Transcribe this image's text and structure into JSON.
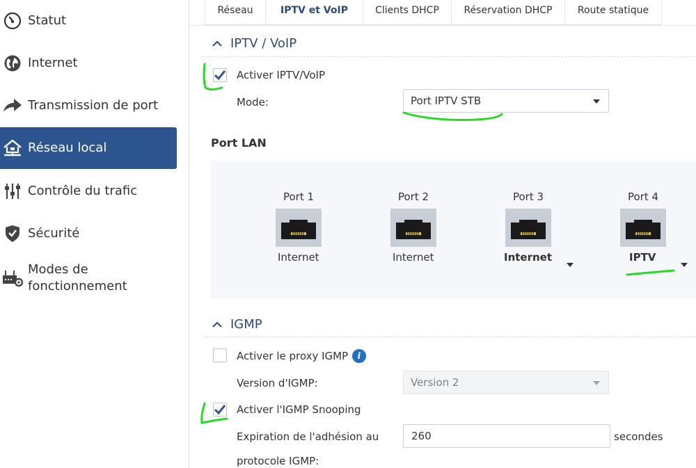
{
  "sidebar": {
    "items": [
      {
        "label": "Statut",
        "icon": "gauge-icon"
      },
      {
        "label": "Internet",
        "icon": "globe-icon"
      },
      {
        "label": "Transmission de port",
        "icon": "arrow-forward-icon"
      },
      {
        "label": "Réseau local",
        "icon": "home-network-icon",
        "active": true
      },
      {
        "label": "Contrôle du trafic",
        "icon": "sliders-icon"
      },
      {
        "label": "Sécurité",
        "icon": "shield-icon"
      },
      {
        "label_line1": "Modes de",
        "label_line2": "fonctionnement",
        "icon": "router-gear-icon"
      }
    ]
  },
  "tabs": [
    {
      "label": "Réseau"
    },
    {
      "label": "IPTV et VoIP",
      "active": true
    },
    {
      "label": "Clients DHCP"
    },
    {
      "label": "Réservation DHCP"
    },
    {
      "label": "Route statique"
    }
  ],
  "iptv": {
    "section_title": "IPTV / VoIP",
    "enable_label": "Activer IPTV/VoIP",
    "enable_checked": true,
    "mode_label": "Mode:",
    "mode_value": "Port IPTV STB"
  },
  "port_lan": {
    "title": "Port LAN",
    "ports": [
      {
        "name": "Port 1",
        "assignment": "Internet",
        "editable": false
      },
      {
        "name": "Port 2",
        "assignment": "Internet",
        "editable": false
      },
      {
        "name": "Port 3",
        "assignment": "Internet",
        "editable": true
      },
      {
        "name": "Port 4",
        "assignment": "IPTV",
        "editable": true
      }
    ]
  },
  "igmp": {
    "section_title": "IGMP",
    "proxy_label": "Activer le proxy IGMP",
    "proxy_checked": false,
    "version_label": "Version d'IGMP:",
    "version_value": "Version 2",
    "snooping_label": "Activer l'IGMP Snooping",
    "snooping_checked": true,
    "expiration_label_line1": "Expiration de l'adhésion au",
    "expiration_label_line2": "protocole IGMP:",
    "expiration_value": "260",
    "expiration_unit": "secondes"
  },
  "colors": {
    "accent": "#2c5590",
    "section_title": "#2c4a7a",
    "check": "#2c5590",
    "info": "#1f6fc5",
    "annotation": "#22dd22"
  }
}
